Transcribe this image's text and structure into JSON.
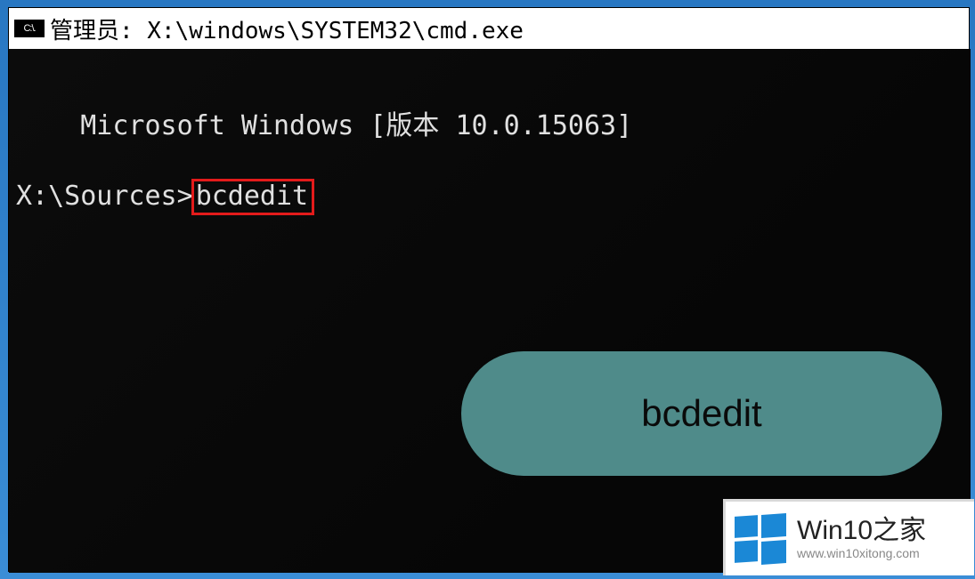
{
  "titlebar": {
    "icon_label": "C:\\.",
    "title": "管理员: X:\\windows\\SYSTEM32\\cmd.exe"
  },
  "terminal": {
    "version_line": "Microsoft Windows [版本 10.0.15063]",
    "prompt": "X:\\Sources>",
    "command": "bcdedit"
  },
  "annotation": {
    "label": "bcdedit"
  },
  "watermark": {
    "brand_main": "Win10",
    "brand_sub": "之家",
    "url": "www.win10xitong.com"
  }
}
